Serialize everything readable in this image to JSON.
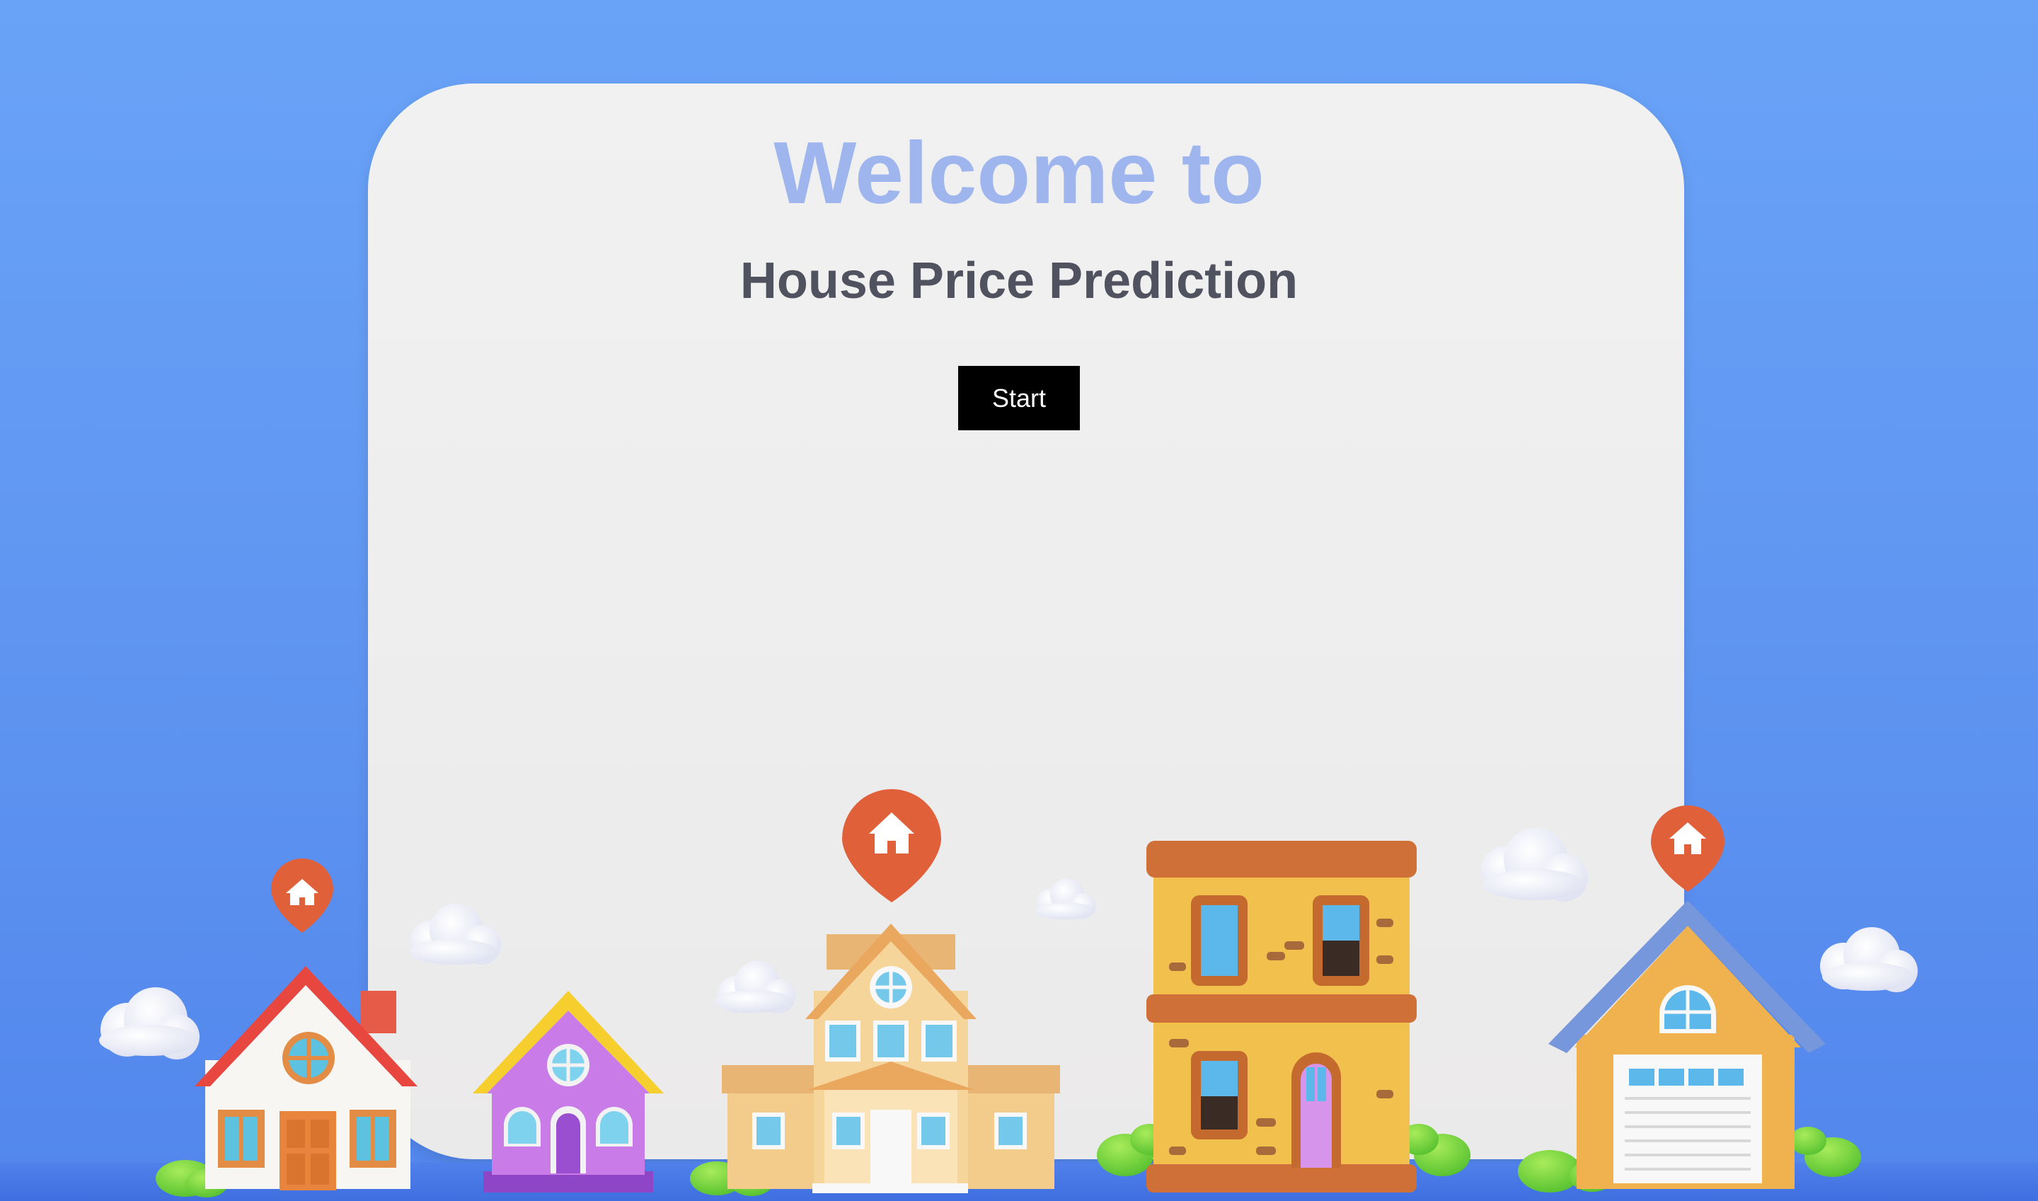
{
  "welcome": {
    "heading": "Welcome to",
    "title": "House Price Prediction",
    "start_label": "Start"
  },
  "illustration": {
    "houses": [
      "white-house-red-roof",
      "purple-house-yellow-roof",
      "beige-mansion",
      "yellow-two-story-building",
      "orange-house-blue-roof-garage"
    ],
    "pins": [
      "location-pin-icon",
      "location-pin-icon",
      "location-pin-icon"
    ],
    "colors": {
      "background": "#6aa3f7",
      "card": "#efeeee",
      "heading": "#9fb5ee",
      "title": "#50525f",
      "button": "#000000",
      "pin": "#e0603a"
    }
  }
}
